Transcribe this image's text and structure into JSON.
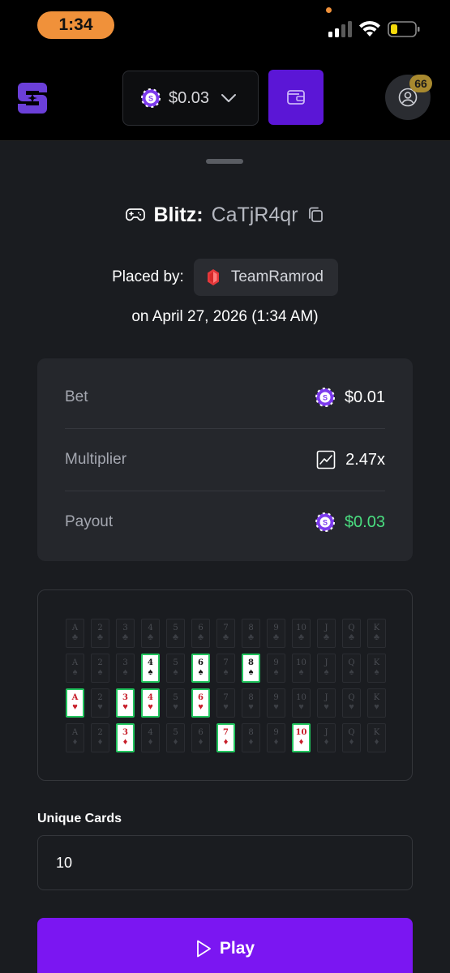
{
  "status_bar": {
    "time": "1:34"
  },
  "header": {
    "balance": "$0.03",
    "notification_count": "66"
  },
  "bet": {
    "game": "Blitz:",
    "id": "CaTjR4qr",
    "placed_by_label": "Placed by:",
    "username": "TeamRamrod",
    "date": "on April 27, 2026 (1:34 AM)"
  },
  "stats": [
    {
      "label": "Bet",
      "value": "$0.01",
      "icon": "coin-icon"
    },
    {
      "label": "Multiplier",
      "value": "2.47x",
      "icon": "chart-icon"
    },
    {
      "label": "Payout",
      "value": "$0.03",
      "icon": "coin-icon"
    }
  ],
  "cards": {
    "ranks": [
      "A",
      "2",
      "3",
      "4",
      "5",
      "6",
      "7",
      "8",
      "9",
      "10",
      "J",
      "Q",
      "K"
    ],
    "suits": [
      "♣",
      "♠",
      "♥",
      "♦"
    ],
    "selected": {
      "spades": [
        "4",
        "6",
        "8"
      ],
      "hearts": [
        "A",
        "3",
        "4",
        "6"
      ],
      "diamonds": [
        "3",
        "7",
        "10"
      ]
    }
  },
  "unique_cards": {
    "label": "Unique Cards",
    "value": "10"
  },
  "play_button": {
    "label": "Play"
  },
  "colors": {
    "accent": "#7b16f2",
    "payout_green": "#4ade80",
    "card_highlight": "#22c55e"
  }
}
